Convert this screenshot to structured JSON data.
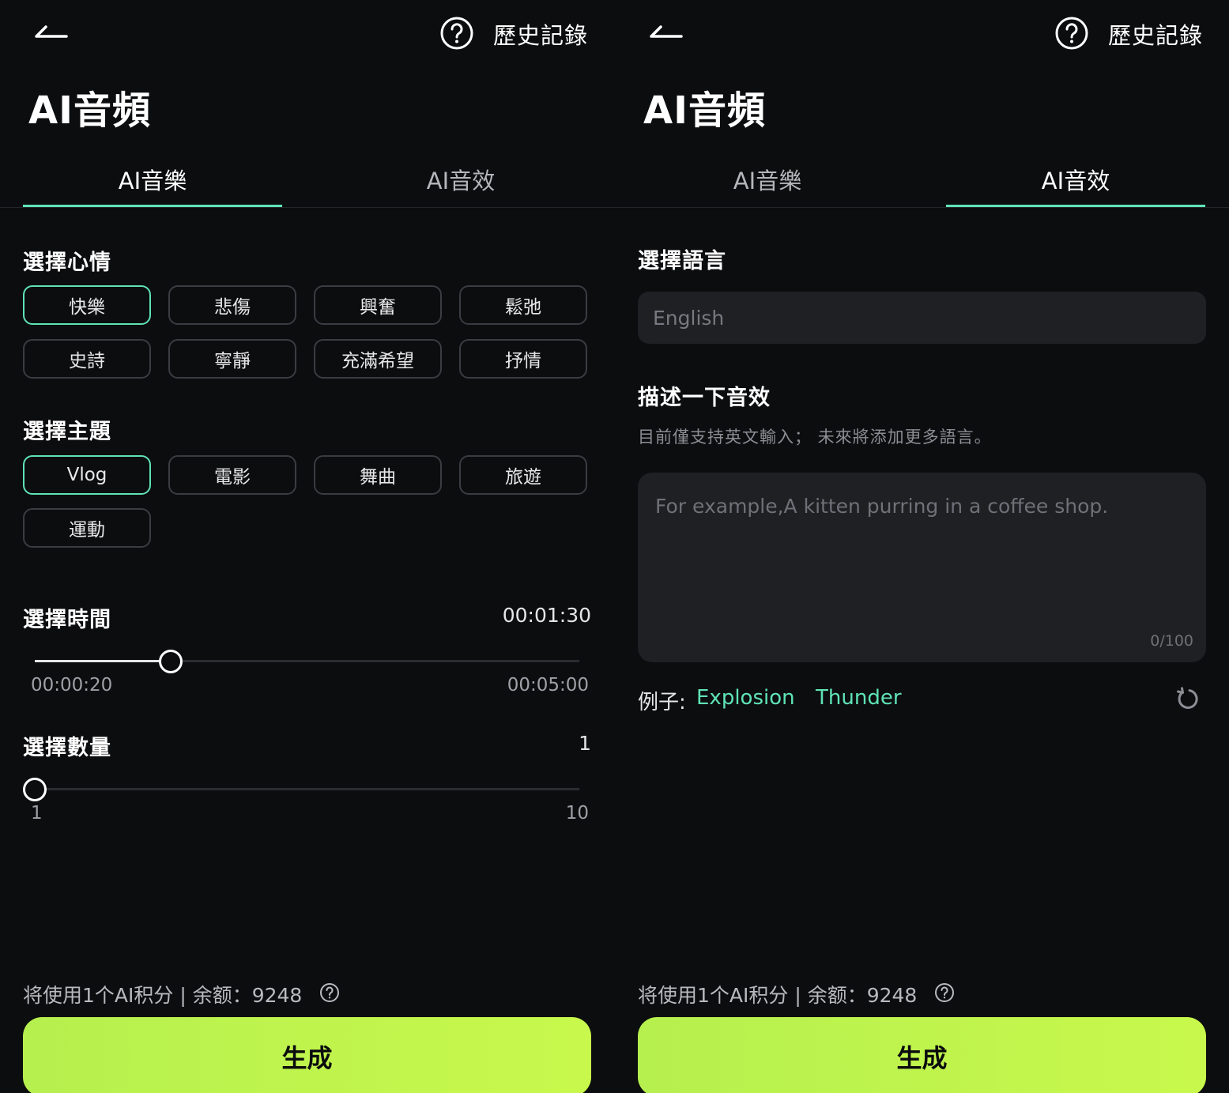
{
  "header": {
    "history_label": "歷史記錄"
  },
  "page_title": "AI音頻",
  "tabs": [
    {
      "label": "AI音樂"
    },
    {
      "label": "AI音效"
    }
  ],
  "music": {
    "mood": {
      "title": "選擇心情",
      "options": [
        "快樂",
        "悲傷",
        "興奮",
        "鬆弛",
        "史詩",
        "寧靜",
        "充滿希望",
        "抒情"
      ],
      "selected": "快樂"
    },
    "theme": {
      "title": "選擇主題",
      "options": [
        "Vlog",
        "電影",
        "舞曲",
        "旅遊",
        "運動"
      ],
      "selected": "Vlog"
    },
    "duration": {
      "title": "選擇時間",
      "value": "00:01:30",
      "min_label": "00:00:20",
      "max_label": "00:05:00",
      "level": 0.25
    },
    "quantity": {
      "title": "選擇數量",
      "value": "1",
      "min_label": "1",
      "max_label": "10",
      "level": 0
    }
  },
  "sfx": {
    "language": {
      "title": "選擇語言",
      "placeholder": "English"
    },
    "describe": {
      "title": "描述一下音效",
      "hint": "目前僅支持英文輸入； 未來將添加更多語言。",
      "placeholder": "For example,A kitten purring in a coffee shop.",
      "counter": "0/100"
    },
    "examples": {
      "label": "例子:",
      "items": [
        "Explosion",
        "Thunder"
      ]
    }
  },
  "footer": {
    "credits_text": "将使用1个AI积分 | 余额：9248",
    "generate_label": "生成"
  },
  "colors": {
    "accent": "#5fe3b5",
    "button": "#c1f54d",
    "background": "#0c0d0f"
  },
  "icons": {
    "back": "back-arrow-icon",
    "help": "help-circle-icon",
    "refresh": "refresh-icon"
  }
}
